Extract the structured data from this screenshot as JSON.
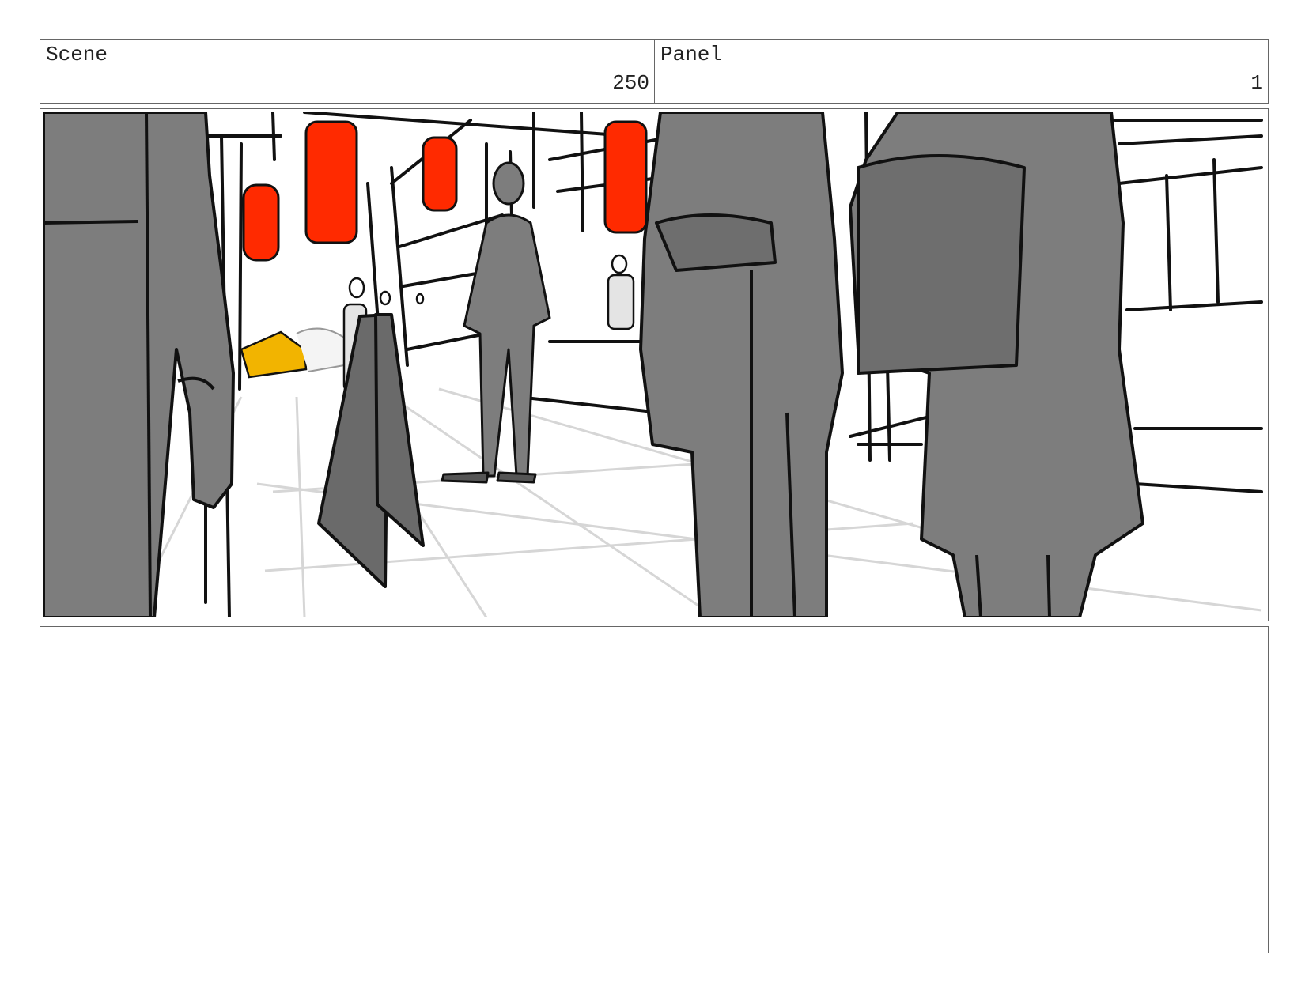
{
  "header": {
    "scene_label": "Scene",
    "scene_number": "250",
    "panel_label": "Panel",
    "panel_number": "1"
  },
  "sketch": {
    "lantern_color": "#ff2a00",
    "taxi_color": "#f2b400",
    "figure_color": "#7d7d7d",
    "line_color": "#111111"
  },
  "notes": {
    "text": ""
  }
}
